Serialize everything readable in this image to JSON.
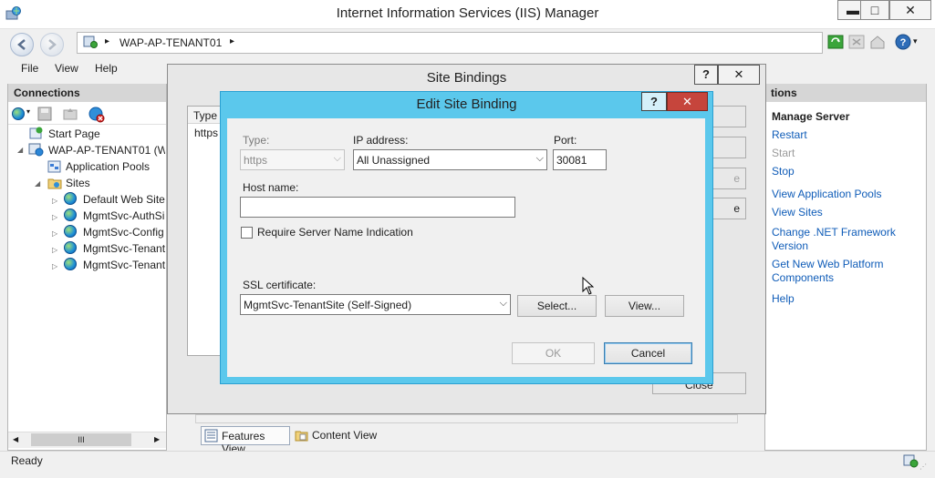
{
  "window": {
    "title": "Internet Information Services (IIS) Manager",
    "minimize": "▬",
    "maximize": "□",
    "close": "✕"
  },
  "address": {
    "path_root_arrow": "▸",
    "server": "WAP-AP-TENANT01",
    "path_end_arrow": "▸"
  },
  "menu": {
    "file": "File",
    "view": "View",
    "help": "Help"
  },
  "connections": {
    "header": "Connections",
    "tree": {
      "start_page": "Start Page",
      "server": "WAP-AP-TENANT01 (WA",
      "app_pools": "Application Pools",
      "sites": "Sites",
      "site_items": [
        "Default Web Site",
        "MgmtSvc-AuthSi",
        "MgmtSvc-Config",
        "MgmtSvc-Tenant",
        "MgmtSvc-Tenant"
      ]
    },
    "scroll_thumb": "III"
  },
  "actions": {
    "header": "tions",
    "manage_server": "Manage Server",
    "restart": "Restart",
    "start": "Start",
    "stop": "Stop",
    "view_app_pools": "View Application Pools",
    "view_sites": "View Sites",
    "change_net": "Change .NET Framework Version",
    "get_new": "Get New Web Platform Components",
    "help": "Help"
  },
  "views": {
    "features": "Features View",
    "content": "Content View"
  },
  "status": {
    "text": "Ready"
  },
  "site_bindings": {
    "title": "Site Bindings",
    "help_btn": "?",
    "close_btn": "✕",
    "col_type": "Type",
    "row_type": "https",
    "side_btn_e": "e",
    "side_btn_e2": "e",
    "close_label": "Close"
  },
  "edit_binding": {
    "title": "Edit Site Binding",
    "help_btn": "?",
    "close_btn": "✕",
    "type_label": "Type:",
    "type_value": "https",
    "ip_label": "IP address:",
    "ip_value": "All Unassigned",
    "port_label": "Port:",
    "port_value": "30081",
    "host_label": "Host name:",
    "host_value": "",
    "sni_label": "Require Server Name Indication",
    "ssl_label": "SSL certificate:",
    "ssl_value": "MgmtSvc-TenantSite (Self-Signed)",
    "select_btn": "Select...",
    "view_btn": "View...",
    "ok_btn": "OK",
    "cancel_btn": "Cancel"
  }
}
